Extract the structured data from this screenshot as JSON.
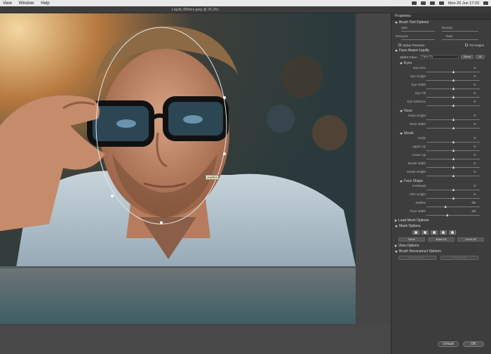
{
  "menubar": {
    "items": [
      "View",
      "Window",
      "Help"
    ],
    "status": "Mon 20 Jun  17:23"
  },
  "titlebar": {
    "title": "Liquify (Before.jpeg @ 25.2%)"
  },
  "canvas": {
    "jawline_tag": "Jawline"
  },
  "panel": {
    "header": "Properties",
    "brush_tool_options": {
      "title": "Brush Tool Options",
      "size_label": "Size",
      "density_label": "Density",
      "pressure_label": "Pressure",
      "rate_label": "Rate",
      "stylus_pressure": "Stylus Pressure",
      "pin_edges": "Pin Edges"
    },
    "face_aware": {
      "title": "Face-Aware Liquify",
      "select_face_label": "Select Face:",
      "select_face_value": "Face #1",
      "reset": "Reset",
      "all": "All",
      "groups": [
        {
          "name": "Eyes",
          "rows": [
            {
              "label": "Eye Size",
              "value": "0"
            },
            {
              "label": "Eye Height",
              "value": "0"
            },
            {
              "label": "Eye Width",
              "value": "0"
            },
            {
              "label": "Eye Tilt",
              "value": "0"
            },
            {
              "label": "Eye Distance",
              "value": "0"
            }
          ]
        },
        {
          "name": "Nose",
          "rows": [
            {
              "label": "Nose Height",
              "value": "0"
            },
            {
              "label": "Nose Width",
              "value": "0"
            }
          ]
        },
        {
          "name": "Mouth",
          "rows": [
            {
              "label": "Smile",
              "value": "0"
            },
            {
              "label": "Upper Lip",
              "value": "0"
            },
            {
              "label": "Lower Lip",
              "value": "0"
            },
            {
              "label": "Mouth Width",
              "value": "0"
            },
            {
              "label": "Mouth Height",
              "value": "0"
            }
          ]
        },
        {
          "name": "Face Shape",
          "rows": [
            {
              "label": "Forehead",
              "value": "0"
            },
            {
              "label": "Chin Height",
              "value": "0"
            },
            {
              "label": "Jawline",
              "value": "-30"
            },
            {
              "label": "Face Width",
              "value": "-23"
            }
          ]
        }
      ]
    },
    "load_mesh": "Load Mesh Options",
    "mask_options": {
      "title": "Mask Options",
      "none": "None",
      "mask_all": "Mask All",
      "invert_all": "Invert All"
    },
    "view_options": "View Options",
    "brush_reconstruct": {
      "title": "Brush Reconstruct Options",
      "reconstruct": "Reconstruct...",
      "restore_all": "Restore All"
    },
    "footer": {
      "default": "Default",
      "ok": "OK"
    }
  }
}
